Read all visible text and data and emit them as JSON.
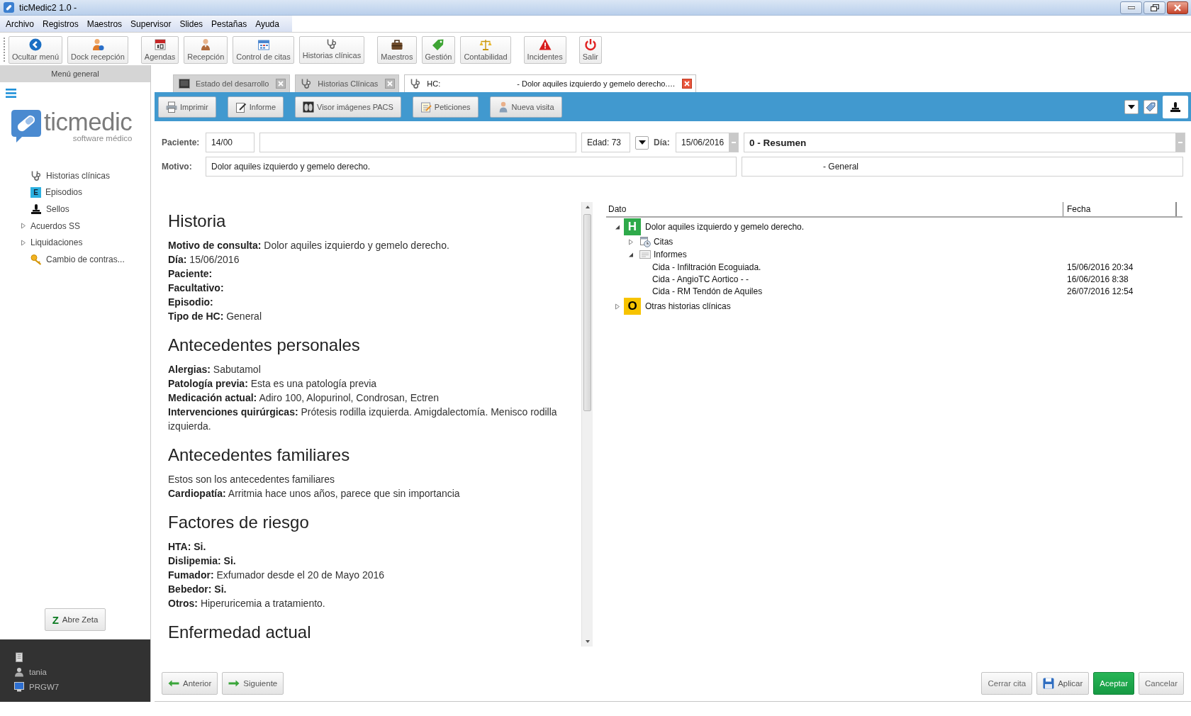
{
  "window": {
    "title": "ticMedic2 1.0 -"
  },
  "menu_bar": [
    "Archivo",
    "Registros",
    "Maestros",
    "Supervisor",
    "Slides",
    "Pestañas",
    "Ayuda"
  ],
  "toolbar": [
    [
      "Ocultar menú",
      "Dock recepción"
    ],
    [
      "Agendas",
      "Recepción",
      "Control de citas",
      "Historias clínicas"
    ],
    [
      "Maestros",
      "Gestión",
      "Contabilidad"
    ],
    [
      "Incidentes"
    ],
    [
      "Salir"
    ]
  ],
  "sidebar": {
    "header": "Menú general",
    "logo": {
      "name": "ticmedic",
      "tagline": "software médico"
    },
    "items": [
      {
        "kind": "link",
        "label": "Historias clínicas"
      },
      {
        "kind": "link",
        "label": "Episodios",
        "badge": "E"
      },
      {
        "kind": "link",
        "label": "Sellos"
      },
      {
        "kind": "folder",
        "label": "Acuerdos SS",
        "expanded": false
      },
      {
        "kind": "folder",
        "label": "Liquidaciones",
        "expanded": false
      },
      {
        "kind": "link",
        "label": "Cambio de contras..."
      }
    ],
    "zeta_button": {
      "badge": "Z",
      "label": "Abre Zeta"
    },
    "status": [
      {
        "kind": "site"
      },
      {
        "kind": "user",
        "text": "tania"
      },
      {
        "kind": "computer",
        "text": "PRGW7"
      }
    ]
  },
  "tabs": [
    {
      "kind": "console",
      "label": "Estado del desarrollo",
      "selected": false
    },
    {
      "kind": "record",
      "label": "Historias Clínicas",
      "selected": false
    },
    {
      "kind": "record",
      "label": "HC:",
      "subject": "- Dolor aquiles izquierdo y gemelo derecho.…",
      "selected": true
    }
  ],
  "action_bar": [
    "Imprimir",
    "Informe",
    "Visor imágenes PACS",
    "Peticiones",
    "Nueva visita"
  ],
  "form": {
    "patient_label": "Paciente:",
    "patient_id": "14/00",
    "age": "Edad: 73",
    "day_label": "Día:",
    "day": "15/06/2016",
    "section": "0 - Resumen",
    "reason_label": "Motivo:",
    "reason": "Dolor aquiles izquierdo y gemelo derecho.",
    "doctor": "- General"
  },
  "history": {
    "sections": [
      {
        "heading": "Historia",
        "lines": [
          {
            "label": "Motivo de consulta:",
            "value": "Dolor aquiles izquierdo y gemelo derecho."
          },
          {
            "label": "Día:",
            "value": "15/06/2016"
          },
          {
            "label": "Paciente:"
          },
          {
            "label": "Facultativo:"
          },
          {
            "label": "Episodio:"
          },
          {
            "label": "Tipo de HC:",
            "value": "General"
          }
        ]
      },
      {
        "heading": "Antecedentes personales",
        "lines": [
          {
            "label": "Alergias:",
            "value": "Sabutamol"
          },
          {
            "label": "Patología previa:",
            "value": "Esta es una patología previa"
          },
          {
            "label": "Medicación actual:",
            "value": "Adiro 100, Alopurinol, Condrosan, Ectren"
          },
          {
            "label": "Intervenciones quirúrgicas:",
            "value": "Prótesis rodilla izquierda. Amigdalectomía. Menisco rodilla izquierda."
          }
        ]
      },
      {
        "heading": "Antecedentes familiares",
        "lines": [
          {
            "value": "Estos son los antecedentes familiares"
          },
          {
            "label": "Cardiopatía:",
            "value": "Arritmia hace unos años, parece que sin importancia"
          }
        ]
      },
      {
        "heading": "Factores de riesgo",
        "lines": [
          {
            "label": "HTA: Si."
          },
          {
            "label": "Dislipemia: Si."
          },
          {
            "label": "Fumador:",
            "value": "Exfumador desde el 20 de Mayo 2016"
          },
          {
            "label": "Bebedor: Si."
          },
          {
            "label": "Otros:",
            "value": "Hiperuricemia a tratamiento."
          }
        ]
      },
      {
        "heading": "Enfermedad actual"
      }
    ]
  },
  "tree": {
    "columns": [
      "Dato",
      "Fecha"
    ],
    "nodes": [
      {
        "badge": "H",
        "color": "#2eaa4a",
        "label": "Dolor aquiles izquierdo y gemelo derecho.",
        "expanded": true,
        "children": [
          {
            "kind": "appointments",
            "label": "Citas",
            "expanded": false
          },
          {
            "kind": "reports",
            "label": "Informes",
            "expanded": true,
            "children": [
              {
                "label": "Cida - Infiltración Ecoguiada.",
                "date": "15/06/2016 20:34"
              },
              {
                "label": "Cida - AngioTC Aortico - -",
                "date": "16/06/2016 8:38"
              },
              {
                "label": "Cida - RM Tendón de Aquiles",
                "date": "26/07/2016 12:54"
              }
            ]
          }
        ]
      },
      {
        "badge": "O",
        "color": "#f7c300",
        "label": "Otras historias clínicas",
        "expanded": false
      }
    ]
  },
  "footer": {
    "nav": [
      "Anterior",
      "Siguiente"
    ],
    "actions": [
      {
        "kind": "plain",
        "label": "Cerrar cita"
      },
      {
        "kind": "save",
        "label": "Aplicar"
      },
      {
        "kind": "primary",
        "label": "Aceptar"
      },
      {
        "kind": "plain",
        "label": "Cancelar"
      }
    ]
  }
}
